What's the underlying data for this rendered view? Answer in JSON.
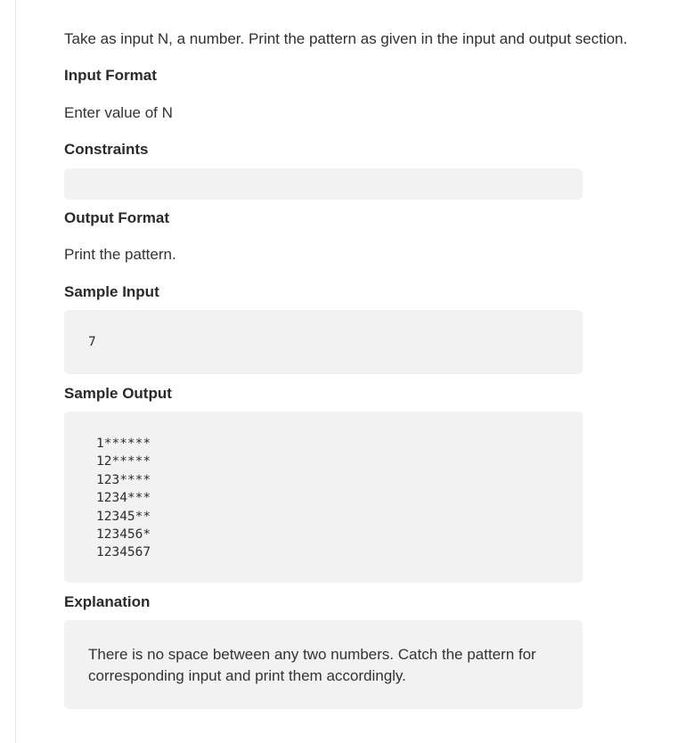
{
  "intro": "Take as input N, a number. Print the pattern as given in the input and output section.",
  "input_format": {
    "heading": "Input Format",
    "text": "Enter value of N"
  },
  "constraints": {
    "heading": "Constraints",
    "text": ""
  },
  "output_format": {
    "heading": "Output Format",
    "text": "Print the pattern."
  },
  "sample_input": {
    "heading": "Sample Input",
    "value": "7"
  },
  "sample_output": {
    "heading": "Sample Output",
    "lines": [
      "1******",
      "12*****",
      "123****",
      "1234***",
      "12345**",
      "123456*",
      "1234567"
    ]
  },
  "explanation": {
    "heading": "Explanation",
    "text": "There is no space between any two numbers. Catch the pattern for corresponding input and print them accordingly."
  }
}
